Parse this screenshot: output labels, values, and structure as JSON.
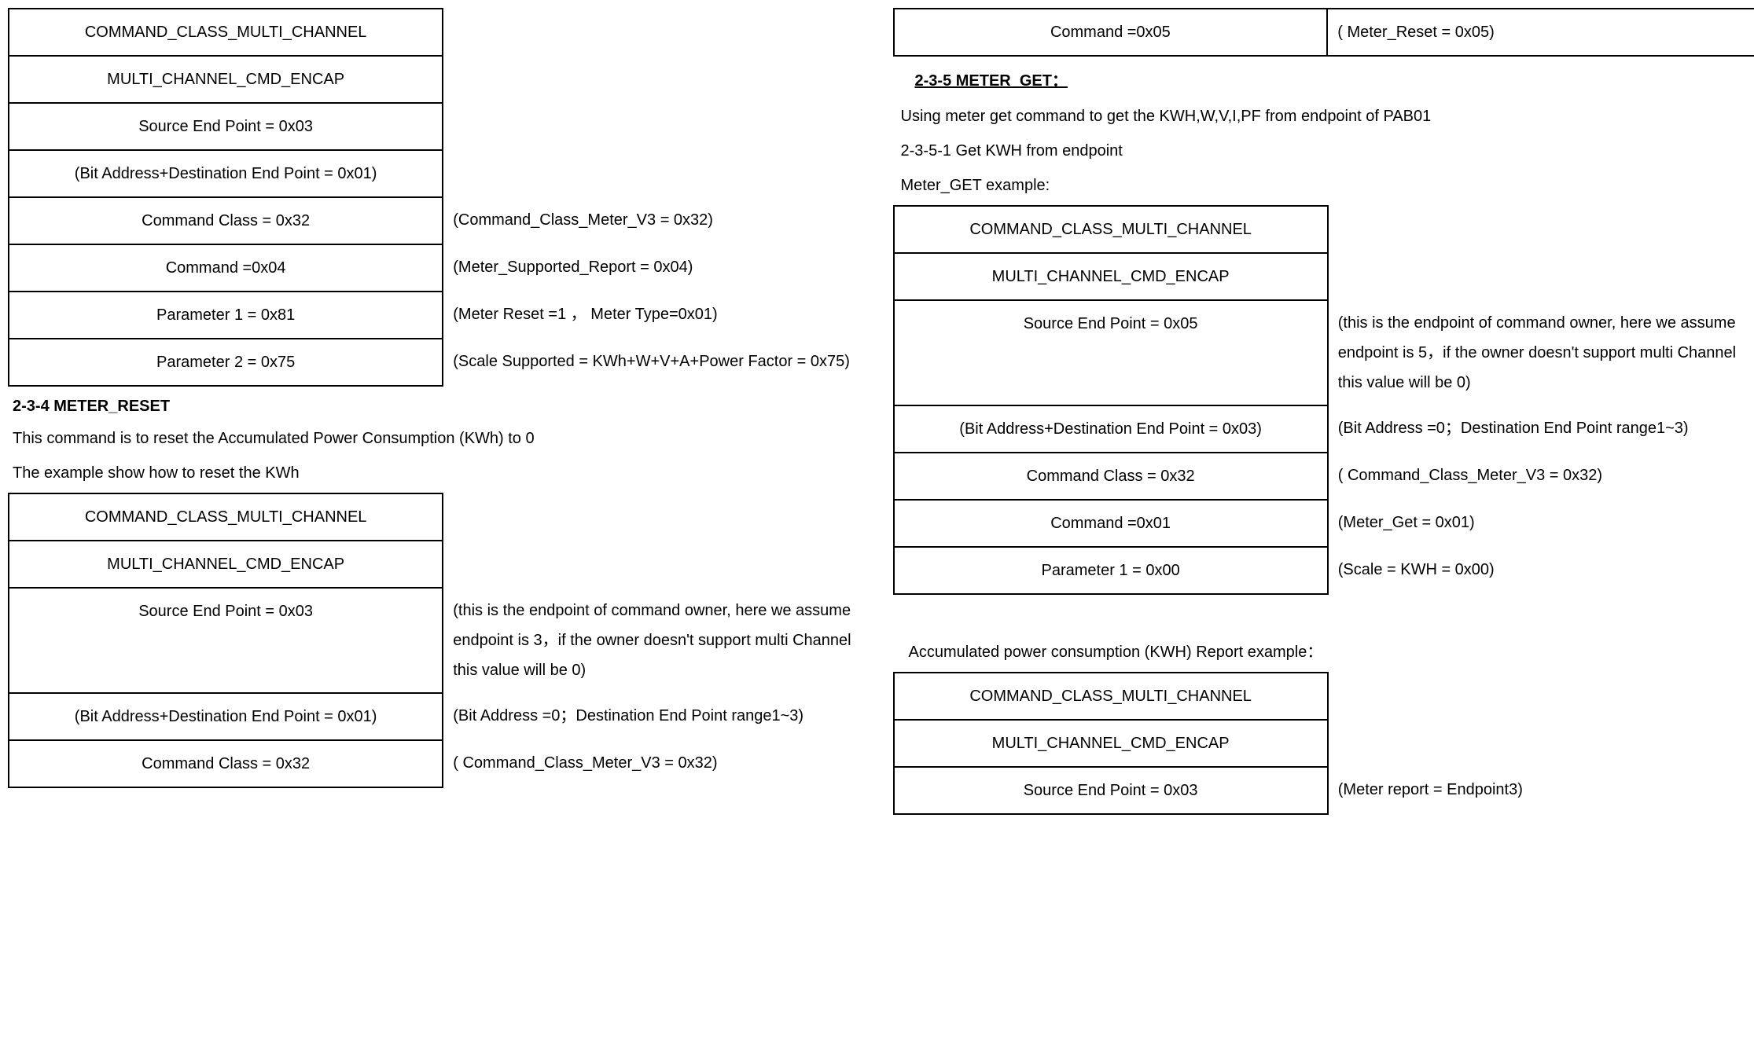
{
  "left": {
    "tableA": {
      "r0l": "COMMAND_CLASS_MULTI_CHANNEL",
      "r1l": "MULTI_CHANNEL_CMD_ENCAP",
      "r2l": "Source End Point = 0x03",
      "r3l": "(Bit Address+Destination End Point = 0x01)",
      "r4l": "Command Class = 0x32",
      "r4r": "(Command_Class_Meter_V3 = 0x32)",
      "r5l": "Command =0x04",
      "r5r": "(Meter_Supported_Report = 0x04)",
      "r6l": "Parameter 1 = 0x81",
      "r6r": "(Meter Reset =1 ， Meter Type=0x01)",
      "r7l": "Parameter 2 = 0x75",
      "r7r": "(Scale Supported = KWh+W+V+A+Power Factor = 0x75)"
    },
    "sec234_h": "2-3-4 METER_RESET",
    "sec234_p1": "This command is to reset the Accumulated Power Consumption (KWh) to 0",
    "sec234_p2": "The example show how to reset the KWh",
    "tableB": {
      "r0l": "COMMAND_CLASS_MULTI_CHANNEL",
      "r1l": "MULTI_CHANNEL_CMD_ENCAP",
      "r2l": "Source End Point = 0x03",
      "r2r": "(this is the endpoint of command owner, here we assume endpoint is 3，if the owner doesn't support multi Channel this value will be 0)",
      "r3l": "(Bit Address+Destination End Point = 0x01)",
      "r3r": "(Bit Address =0；Destination End Point range1~3)",
      "r4l": "Command Class = 0x32",
      "r4r": "( Command_Class_Meter_V3 = 0x32)"
    }
  },
  "right": {
    "topTable": {
      "l": "Command =0x05",
      "r": "( Meter_Reset = 0x05)"
    },
    "sec235_h": "2-3-5 METER_GET：",
    "sec235_p1": "Using meter get command to get the KWH,W,V,I,PF from endpoint of PAB01",
    "sec235_p2": "2-3-5-1 Get KWH from endpoint",
    "sec235_p3": "Meter_GET example:",
    "tableC": {
      "r0l": "COMMAND_CLASS_MULTI_CHANNEL",
      "r1l": "MULTI_CHANNEL_CMD_ENCAP",
      "r2l": "Source End Point = 0x05",
      "r2r": "(this is the endpoint of command owner, here we assume endpoint is 5，if the owner doesn't support multi Channel this value will be 0)",
      "r3l": "(Bit Address+Destination End Point = 0x03)",
      "r3r": "(Bit Address =0；Destination End Point range1~3)",
      "r4l": "Command Class = 0x32",
      "r4r": "( Command_Class_Meter_V3 = 0x32)",
      "r5l": "Command =0x01",
      "r5r": "(Meter_Get = 0x01)",
      "r6l": "Parameter 1 = 0x00",
      "r6r": "(Scale = KWH = 0x00)"
    },
    "tableD_h": "Accumulated power consumption (KWH) Report example：",
    "tableD": {
      "r0l": "COMMAND_CLASS_MULTI_CHANNEL",
      "r1l": "MULTI_CHANNEL_CMD_ENCAP",
      "r2l": "Source End Point = 0x03",
      "r2r": "(Meter report = Endpoint3)"
    }
  }
}
